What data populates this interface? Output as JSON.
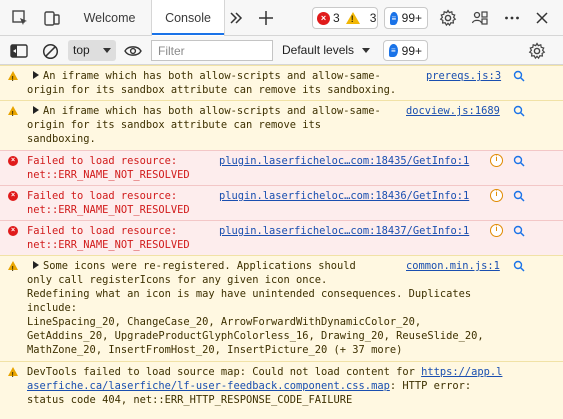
{
  "tabs": {
    "welcome": "Welcome",
    "console": "Console",
    "more_tabs_icon": "chevron-double-right-icon",
    "new_tab_icon": "plus-icon"
  },
  "counts": {
    "errors": "3",
    "warnings": "3",
    "issues": "99+"
  },
  "toolbar": {
    "context": "top",
    "filter_placeholder": "Filter",
    "filter_value": "",
    "levels": "Default levels",
    "issues": "99+"
  },
  "messages": [
    {
      "type": "warning",
      "expandable": true,
      "lines": [
        "An iframe which has both allow-scripts and allow-same-",
        "origin for its sandbox attribute can remove its sandboxing."
      ],
      "source": "prereqs.js:3"
    },
    {
      "type": "warning",
      "expandable": true,
      "lines": [
        "An iframe which has both allow-scripts and allow-same-",
        "origin for its sandbox attribute can remove its",
        "sandboxing."
      ],
      "source": "docview.js:1689"
    },
    {
      "type": "error",
      "lines": [
        "Failed to load resource:",
        "net::ERR_NAME_NOT_RESOLVED"
      ],
      "source": "plugin.laserficheloc…com:18435/GetInfo:1"
    },
    {
      "type": "error",
      "lines": [
        "Failed to load resource:",
        "net::ERR_NAME_NOT_RESOLVED"
      ],
      "source": "plugin.laserficheloc…com:18436/GetInfo:1"
    },
    {
      "type": "error",
      "lines": [
        "Failed to load resource:",
        "net::ERR_NAME_NOT_RESOLVED"
      ],
      "source": "plugin.laserficheloc…com:18437/GetInfo:1"
    },
    {
      "type": "warning",
      "expandable": true,
      "lines": [
        "Some icons were re-registered. Applications should",
        "only call registerIcons for any given icon once.",
        "Redefining what an icon is may have unintended consequences. Duplicates",
        "include:",
        "LineSpacing_20, ChangeCase_20, ArrowForwardWithDynamicColor_20,",
        "GetAddins_20, UpgradeProductGlyphColorless_16, Drawing_20, ReuseSlide_20,",
        "MathZone_20, InsertFromHost_20, InsertPicture_20 (+ 37 more)"
      ],
      "source": "common.min.js:1"
    },
    {
      "type": "warning",
      "expandable": false,
      "line1_prefix": "DevTools failed to load source map: Could not load content for ",
      "link_part1": "https://app.l",
      "link_part2": "aserfiche.ca/laserfiche/lf-user-feedback.component.css.map",
      "line2_suffix": ": HTTP error:",
      "line3": "status code 404, net::ERR_HTTP_RESPONSE_CODE_FAILURE"
    }
  ],
  "colors": {
    "accent": "#1a73e8",
    "error_bg": "#fdeded",
    "error_text": "#d11a1a",
    "warning_bg": "#fff8e1",
    "link": "#1a4fb0"
  },
  "icons": {
    "inspect": "inspect-element-icon",
    "device": "device-emulation-icon",
    "gear": "gear-icon",
    "connect": "people-connect-icon",
    "more": "more-dots-icon",
    "close": "close-icon",
    "sidebar": "sidebar-toggle-icon",
    "clear": "clear-console-icon",
    "eye": "eye-icon",
    "settings": "gear-icon",
    "search": "magnifier-icon",
    "insight": "insights-icon"
  }
}
